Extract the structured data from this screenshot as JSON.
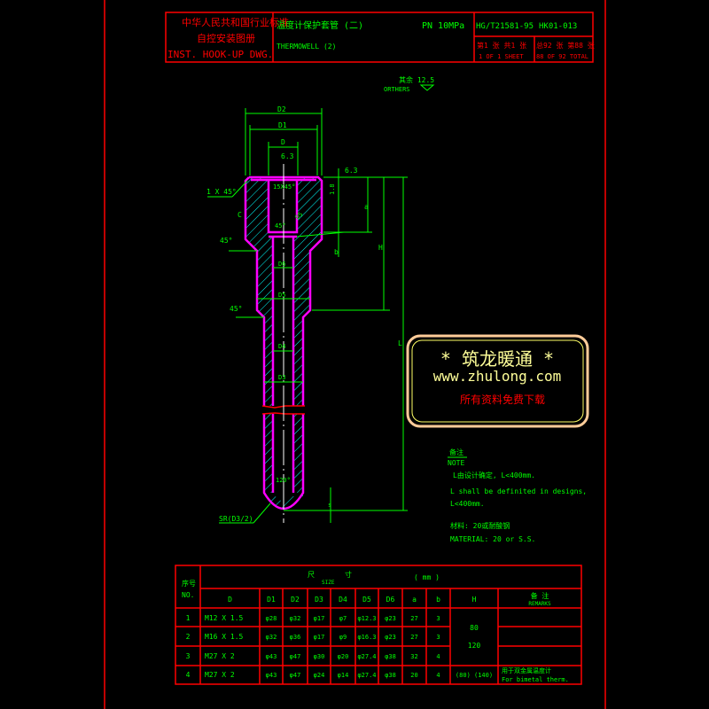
{
  "colors": {
    "frame": "#ff0000",
    "text": "#00ff00",
    "part": "#ff00ff",
    "hatch": "#00ffff",
    "watermark": "#ffcc99"
  },
  "title_block": {
    "org_cn": "中华人民共和国行业标准",
    "book_cn": "自控安装图册",
    "book_en": "INST. HOOK-UP DWG.",
    "title_cn": "温度计保护套管 (二)",
    "title_en": "THERMOWELL (2)",
    "pressure": "PN 10MPa",
    "standard": "HG/T21581-95",
    "drawing_no": "HK01-013",
    "sheet_cn": "第1 张 共1 张",
    "sheet_en": "1 OF 1 SHEET",
    "total_cn": "总92 张 第88 张",
    "total_en": "88 OF 92 TOTAL"
  },
  "drawing": {
    "roughness_others_cn": "其余 12.5",
    "roughness_others_en": "ORTHERS",
    "dim_D2": "D2",
    "dim_D1": "D1",
    "dim_D": "D",
    "rough_63a": "6.3",
    "rough_63b": "6.3",
    "chamfer": "1 X 45°",
    "thread_note": "15X45°",
    "dim_C": "C",
    "angle_45_top": "45°",
    "angle_45_inner": "45°",
    "angle_45_head": "45°",
    "angle_45_body": "45°",
    "dim_18": "1.8",
    "dim_a": "a",
    "dim_b": "b",
    "dim_H": "H",
    "dim_L": "L",
    "dim_D5": "D5",
    "dim_D6": "D6",
    "dim_D4": "D4",
    "dim_D3": "D3",
    "angle_120": "120°",
    "sr": "SR(D3/2)",
    "dim_s": "s"
  },
  "watermark": {
    "title": "* 筑龙暖通 *",
    "url": "www.zhulong.com",
    "slogan": "所有资料免费下载"
  },
  "notes": {
    "heading_cn": "备注",
    "heading_en": "NOTE",
    "line1_cn": "L由设计确定, L<400mm.",
    "line2_en": "L shall be definited in designs,",
    "line3_en": "L<400mm.",
    "material_cn": "材料: 20或耐酸钢",
    "material_en": "MATERIAL: 20 or S.S."
  },
  "table": {
    "no_cn": "序号",
    "no_en": "NO.",
    "size_cn_1": "尺",
    "size_cn_2": "寸",
    "size_en": "SIZE",
    "unit": "( mm )",
    "remarks_cn": "备 注",
    "remarks_en": "REMARKS",
    "columns": [
      "D",
      "D1",
      "D2",
      "D3",
      "D4",
      "D5",
      "D6",
      "a",
      "b",
      "H"
    ],
    "rows": [
      {
        "no": "1",
        "cells": [
          "M12 X 1.5",
          "φ28",
          "φ32",
          "φ17",
          "φ7",
          "φ12.3",
          "φ23",
          "27",
          "3"
        ],
        "remark_cn": "",
        "remark_en": ""
      },
      {
        "no": "2",
        "cells": [
          "M16 X 1.5",
          "φ32",
          "φ36",
          "φ17",
          "φ9",
          "φ16.3",
          "φ23",
          "27",
          "3"
        ],
        "remark_cn": "",
        "remark_en": ""
      },
      {
        "no": "3",
        "cells": [
          "M27 X 2",
          "φ43",
          "φ47",
          "φ30",
          "φ20",
          "φ27.4",
          "φ38",
          "32",
          "4"
        ],
        "remark_cn": "",
        "remark_en": ""
      },
      {
        "no": "4",
        "cells": [
          "M27 X 2",
          "φ43",
          "φ47",
          "φ24",
          "φ14",
          "φ27.4",
          "φ38",
          "20",
          "4"
        ],
        "remark_cn": "用于双金属温度计",
        "remark_en": "For bimetal therm."
      }
    ],
    "H_merged_1": "80",
    "H_merged_2": "120",
    "H_row4": "(80) (140)"
  }
}
